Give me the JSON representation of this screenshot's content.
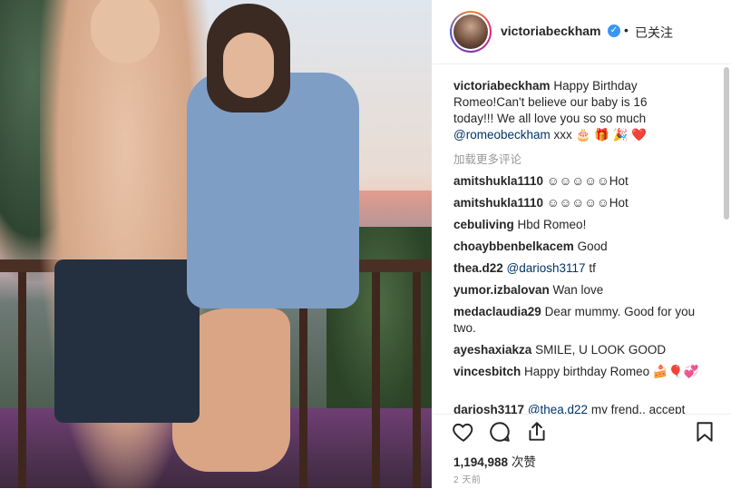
{
  "post_author": "victoriabeckham",
  "follow_dot": "•",
  "follow_status": "已关注",
  "verified_mark": "✓",
  "caption": {
    "username": "victoriabeckham",
    "text": " Happy Birthday Romeo!Can't believe our baby is 16 today!!! We all love you so so much ",
    "mention": "@romeobeckham",
    "tail": " xxx 🎂 🎁 🎉 ❤️"
  },
  "load_more": "加载更多评论",
  "comments": [
    {
      "user": "amitshukla1110",
      "text": "☺☺☺☺☺Hot"
    },
    {
      "user": "amitshukla1110",
      "text": "☺☺☺☺☺Hot"
    },
    {
      "user": "cebuliving",
      "text": "Hbd Romeo!"
    },
    {
      "user": "choaybbenbelkacem",
      "text": "Good"
    },
    {
      "user": "thea.d22",
      "mention": "@dariosh3117",
      "text": "tf"
    },
    {
      "user": "yumor.izbalovan",
      "text": "Wan love"
    },
    {
      "user": "medaclaudia29",
      "text": "Dear mummy. Good for you two."
    },
    {
      "user": "ayeshaxiakza",
      "text": "SMILE, U LOOK GOOD"
    },
    {
      "user": "vincesbitch",
      "text": "Happy birthday Romeo 🍰🎈💞"
    },
    {
      "user": "dariosh3117",
      "mention": "@thea.d22",
      "text": "my frend.. accept"
    }
  ],
  "likes_count": "1,194,988",
  "likes_unit": "次赞",
  "time_ago": "2 天前",
  "icons": [
    "heart-icon",
    "comment-icon",
    "share-icon",
    "bookmark-icon",
    "verified-badge-icon"
  ],
  "colors": {
    "verified": "#3897f0",
    "mention": "#003569",
    "muted": "#999999"
  }
}
